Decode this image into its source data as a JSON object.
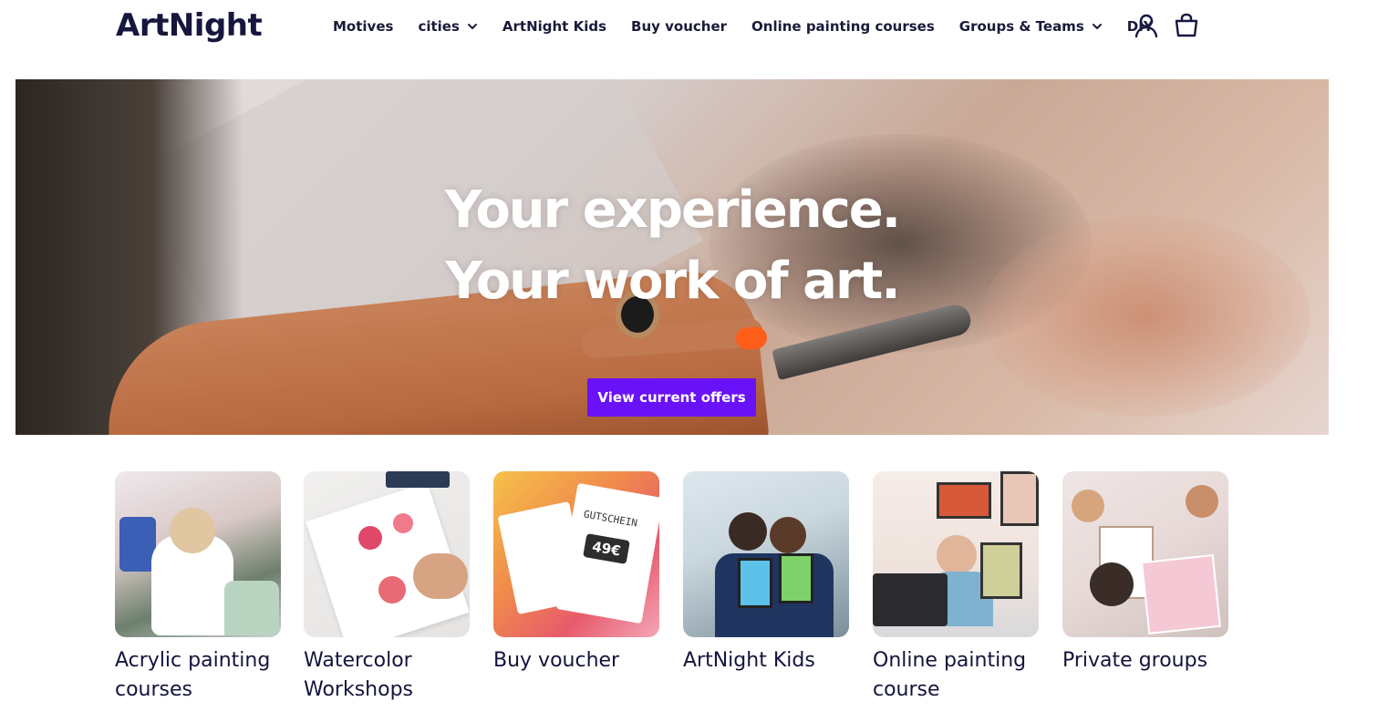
{
  "header": {
    "logo": "ArtNight",
    "nav": [
      {
        "label": "Motives"
      },
      {
        "label": "cities"
      },
      {
        "label": "ArtNight Kids"
      },
      {
        "label": "Buy voucher"
      },
      {
        "label": "Online painting courses"
      },
      {
        "label": "Groups & Teams"
      },
      {
        "label": "DIY"
      }
    ],
    "icons": {
      "account": "user-icon",
      "cart": "shopping-bag-icon"
    }
  },
  "hero": {
    "title_line1": "Your experience.",
    "title_line2": "Your work of art.",
    "cta_label": "View current offers"
  },
  "categories": [
    {
      "title": "Acrylic painting courses"
    },
    {
      "title": "Watercolor Workshops"
    },
    {
      "title": "Buy voucher"
    },
    {
      "title": "ArtNight Kids"
    },
    {
      "title": "Online painting course"
    },
    {
      "title": "Private groups"
    }
  ],
  "voucher_card": {
    "heading": "GUTSCHEIN",
    "amount": "49€"
  },
  "colors": {
    "accent": "#6a12f7",
    "text": "#14143c",
    "nail": "#ff5d1a"
  }
}
